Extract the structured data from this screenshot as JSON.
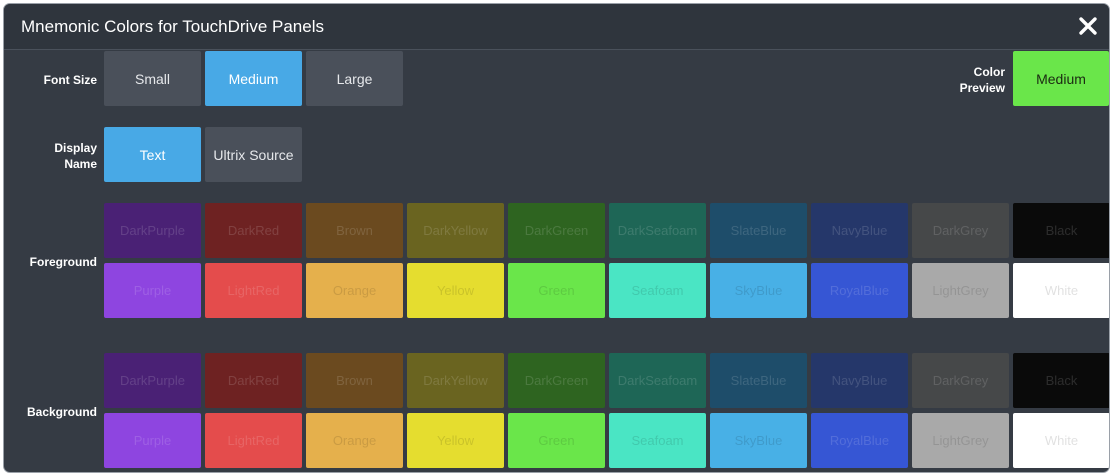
{
  "dialog": {
    "title": "Mnemonic Colors for TouchDrive Panels"
  },
  "font_size": {
    "label": "Font Size",
    "options": [
      "Small",
      "Medium",
      "Large"
    ],
    "selected": "Medium"
  },
  "display_name": {
    "label_line1": "Display",
    "label_line2": "Name",
    "options": [
      "Text",
      "Ultrix Source"
    ],
    "selected": "Text"
  },
  "color_preview": {
    "label_line1": "Color",
    "label_line2": "Preview",
    "text": "Medium",
    "color": "#6ae64a"
  },
  "foreground": {
    "label": "Foreground",
    "dark_row": [
      {
        "name": "DarkPurple",
        "color": "#4a2175"
      },
      {
        "name": "DarkRed",
        "color": "#6e2222"
      },
      {
        "name": "Brown",
        "color": "#6b4a1f"
      },
      {
        "name": "DarkYellow",
        "color": "#6a6420"
      },
      {
        "name": "DarkGreen",
        "color": "#2e6420"
      },
      {
        "name": "DarkSeafoam",
        "color": "#1e6656"
      },
      {
        "name": "SlateBlue",
        "color": "#1e4d6a"
      },
      {
        "name": "NavyBlue",
        "color": "#25376a"
      },
      {
        "name": "DarkGrey",
        "color": "#464849"
      },
      {
        "name": "Black",
        "color": "#0a0a0a"
      }
    ],
    "light_row": [
      {
        "name": "Purple",
        "color": "#8e45e0"
      },
      {
        "name": "LightRed",
        "color": "#e44c4c"
      },
      {
        "name": "Orange",
        "color": "#e5b04c"
      },
      {
        "name": "Yellow",
        "color": "#e5dd2f"
      },
      {
        "name": "Green",
        "color": "#6ae64a"
      },
      {
        "name": "Seafoam",
        "color": "#4ae5c4"
      },
      {
        "name": "SkyBlue",
        "color": "#48b0e6"
      },
      {
        "name": "RoyalBlue",
        "color": "#3656d4"
      },
      {
        "name": "LightGrey",
        "color": "#a9a9a9"
      },
      {
        "name": "White",
        "color": "#ffffff"
      }
    ]
  },
  "background": {
    "label": "Background",
    "dark_row": [
      {
        "name": "DarkPurple",
        "color": "#4a2175"
      },
      {
        "name": "DarkRed",
        "color": "#6e2222"
      },
      {
        "name": "Brown",
        "color": "#6b4a1f"
      },
      {
        "name": "DarkYellow",
        "color": "#6a6420"
      },
      {
        "name": "DarkGreen",
        "color": "#2e6420"
      },
      {
        "name": "DarkSeafoam",
        "color": "#1e6656"
      },
      {
        "name": "SlateBlue",
        "color": "#1e4d6a"
      },
      {
        "name": "NavyBlue",
        "color": "#25376a"
      },
      {
        "name": "DarkGrey",
        "color": "#464849"
      },
      {
        "name": "Black",
        "color": "#0a0a0a"
      }
    ],
    "light_row": [
      {
        "name": "Purple",
        "color": "#8e45e0"
      },
      {
        "name": "LightRed",
        "color": "#e44c4c"
      },
      {
        "name": "Orange",
        "color": "#e5b04c"
      },
      {
        "name": "Yellow",
        "color": "#e5dd2f"
      },
      {
        "name": "Green",
        "color": "#6ae64a"
      },
      {
        "name": "Seafoam",
        "color": "#4ae5c4"
      },
      {
        "name": "SkyBlue",
        "color": "#48b0e6"
      },
      {
        "name": "RoyalBlue",
        "color": "#3656d4"
      },
      {
        "name": "LightGrey",
        "color": "#a9a9a9"
      },
      {
        "name": "White",
        "color": "#ffffff"
      }
    ]
  }
}
